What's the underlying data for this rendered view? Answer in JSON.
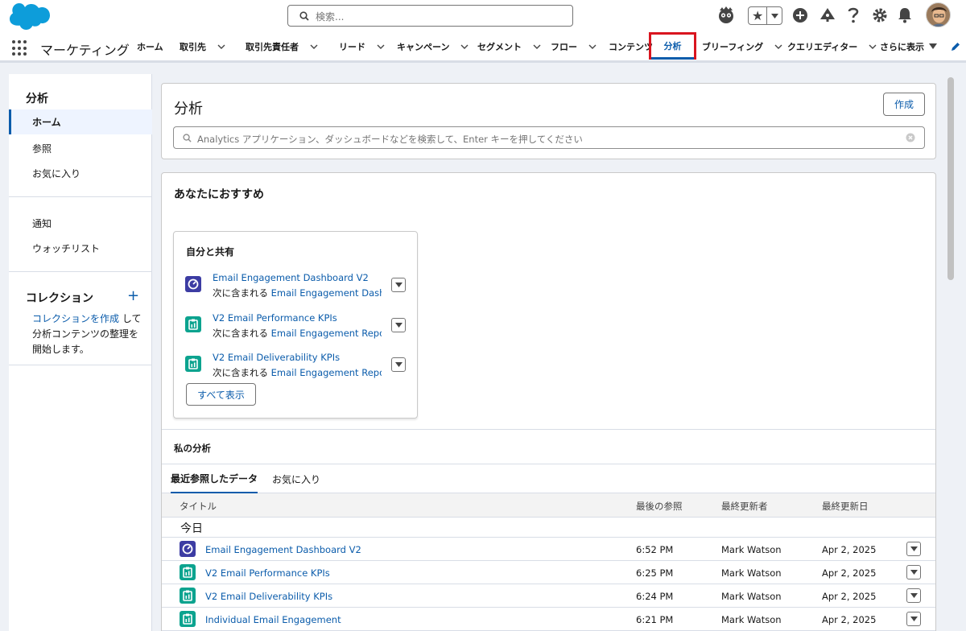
{
  "header": {
    "search_placeholder": "検索...",
    "icons": [
      "salesforce-cloud-logo",
      "search-icon",
      "einstein-icon",
      "star-icon",
      "add-icon",
      "trailhead-icon",
      "help-icon",
      "setup-gear-icon",
      "notification-bell-icon",
      "avatar"
    ]
  },
  "nav": {
    "app_name": "マーケティング",
    "items": [
      {
        "label": "ホーム",
        "has_menu": false
      },
      {
        "label": "取引先",
        "has_menu": true
      },
      {
        "label": "取引先責任者",
        "has_menu": true
      },
      {
        "label": "リード",
        "has_menu": true
      },
      {
        "label": "キャンペーン",
        "has_menu": true
      },
      {
        "label": "セグメント",
        "has_menu": true
      },
      {
        "label": "フロー",
        "has_menu": true
      },
      {
        "label": "コンテンツ",
        "has_menu": false
      },
      {
        "label": "分析",
        "has_menu": false,
        "active": true
      },
      {
        "label": "ブリーフィング",
        "has_menu": true
      },
      {
        "label": "クエリエディター",
        "has_menu": true
      },
      {
        "label": "さらに表示",
        "has_menu": true
      }
    ]
  },
  "sidebar": {
    "title": "分析",
    "items": [
      {
        "label": "ホーム",
        "active": true
      },
      {
        "label": "参照"
      },
      {
        "label": "お気に入り"
      }
    ],
    "items2": [
      {
        "label": "通知"
      },
      {
        "label": "ウォッチリスト"
      }
    ],
    "collection_title": "コレクション",
    "collection_add": "+",
    "collection_link": "コレクションを作成",
    "collection_text_1": "して",
    "collection_text_2": "分析コンテンツの整理を",
    "collection_text_3": "開始します。"
  },
  "main": {
    "title": "分析",
    "create_label": "作成",
    "search_placeholder": "Analytics アプリケーション、ダッシュボードなどを検索して、Enter キーを押してください",
    "recommend_title": "あなたにおすすめ",
    "shared": {
      "title": "自分と共有",
      "items": [
        {
          "title": "Email Engagement Dashboard V2",
          "sub_prefix": "次に含まれる",
          "sub_link": "Email Engagement Dash...",
          "type": "dashboard"
        },
        {
          "title": "V2 Email Performance KPIs",
          "sub_prefix": "次に含まれる",
          "sub_link": "Email Engagement Repo...",
          "type": "report"
        },
        {
          "title": "V2 Email Deliverability KPIs",
          "sub_prefix": "次に含まれる",
          "sub_link": "Email Engagement Repo...",
          "type": "report"
        }
      ],
      "show_all": "すべて表示"
    },
    "my_title": "私の分析",
    "tabs": [
      "最近参照したデータ",
      "お気に入り"
    ],
    "columns": [
      "タイトル",
      "最後の参照",
      "最終更新者",
      "最終更新日"
    ],
    "group_label": "今日",
    "rows": [
      {
        "title": "Email Engagement Dashboard V2",
        "viewed": "6:52 PM",
        "by": "Mark Watson",
        "date": "Apr 2, 2025",
        "type": "dashboard"
      },
      {
        "title": "V2 Email Performance KPIs",
        "viewed": "6:25 PM",
        "by": "Mark Watson",
        "date": "Apr 2, 2025",
        "type": "report"
      },
      {
        "title": "V2 Email Deliverability KPIs",
        "viewed": "6:24 PM",
        "by": "Mark Watson",
        "date": "Apr 2, 2025",
        "type": "report"
      },
      {
        "title": "Individual Email Engagement",
        "viewed": "6:21 PM",
        "by": "Mark Watson",
        "date": "Apr 2, 2025",
        "type": "report"
      }
    ]
  },
  "colors": {
    "brand": "#0b5cab",
    "highlight": "#d9151f",
    "dashboard_icon": "#3c3ca3",
    "report_icon": "#0ca38f"
  }
}
